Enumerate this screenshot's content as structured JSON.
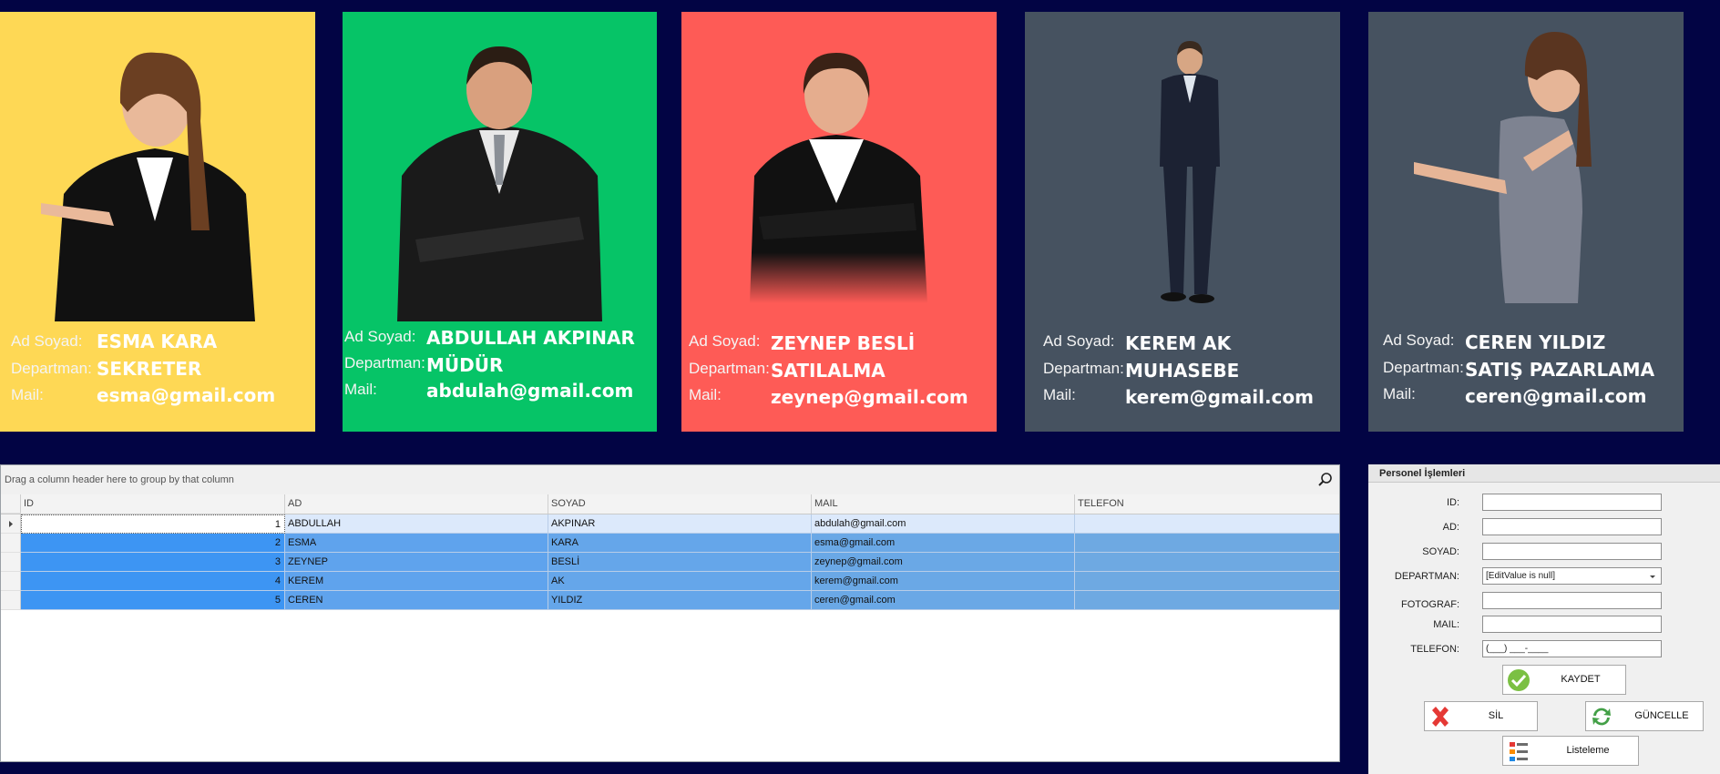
{
  "labels": {
    "name": "Ad Soyad:",
    "department": "Departman:",
    "mail": "Mail:"
  },
  "cards": [
    {
      "name": "ESMA KARA",
      "department": "SEKRETER",
      "mail": "esma@gmail.com",
      "bg": "#fed855"
    },
    {
      "name": "ABDULLAH AKPINAR",
      "department": "MÜDÜR",
      "mail": "abdulah@gmail.com",
      "bg": "#06c467"
    },
    {
      "name": "ZEYNEP BESLİ",
      "department": "SATILALMA",
      "mail": "zeynep@gmail.com",
      "bg": "#fe5b56"
    },
    {
      "name": "KEREM AK",
      "department": "MUHASEBE",
      "mail": "kerem@gmail.com",
      "bg": "#465260"
    },
    {
      "name": "CEREN YILDIZ",
      "department": "SATIŞ PAZARLAMA",
      "mail": "ceren@gmail.com",
      "bg": "#465260"
    }
  ],
  "grid": {
    "group_hint": "Drag a column header here to group by that column",
    "columns": [
      "ID",
      "AD",
      "SOYAD",
      "MAIL",
      "TELEFON"
    ],
    "rows": [
      [
        "1",
        "ABDULLAH",
        "AKPINAR",
        "abdulah@gmail.com",
        ""
      ],
      [
        "2",
        "ESMA",
        "KARA",
        "esma@gmail.com",
        ""
      ],
      [
        "3",
        "ZEYNEP",
        "BESLİ",
        "zeynep@gmail.com",
        ""
      ],
      [
        "4",
        "KEREM",
        "AK",
        "kerem@gmail.com",
        ""
      ],
      [
        "5",
        "CEREN",
        "YILDIZ",
        "ceren@gmail.com",
        ""
      ]
    ]
  },
  "panel": {
    "title": "Personel İşlemleri",
    "fields": {
      "id_label": "ID:",
      "ad_label": "AD:",
      "soyad_label": "SOYAD:",
      "departman_label": "DEPARTMAN:",
      "departman_value": "[EditValue is null]",
      "fotograf_label": "FOTOGRAF:",
      "mail_label": "MAIL:",
      "telefon_label": "TELEFON:",
      "telefon_mask": "(___) ___-____"
    },
    "buttons": {
      "save": "KAYDET",
      "delete": "SİL",
      "update": "GÜNCELLE",
      "list": "Listeleme"
    }
  },
  "colors": {
    "background": "#020444",
    "selection": "#3d95f3",
    "selection_alt": "#6aa8e6"
  }
}
